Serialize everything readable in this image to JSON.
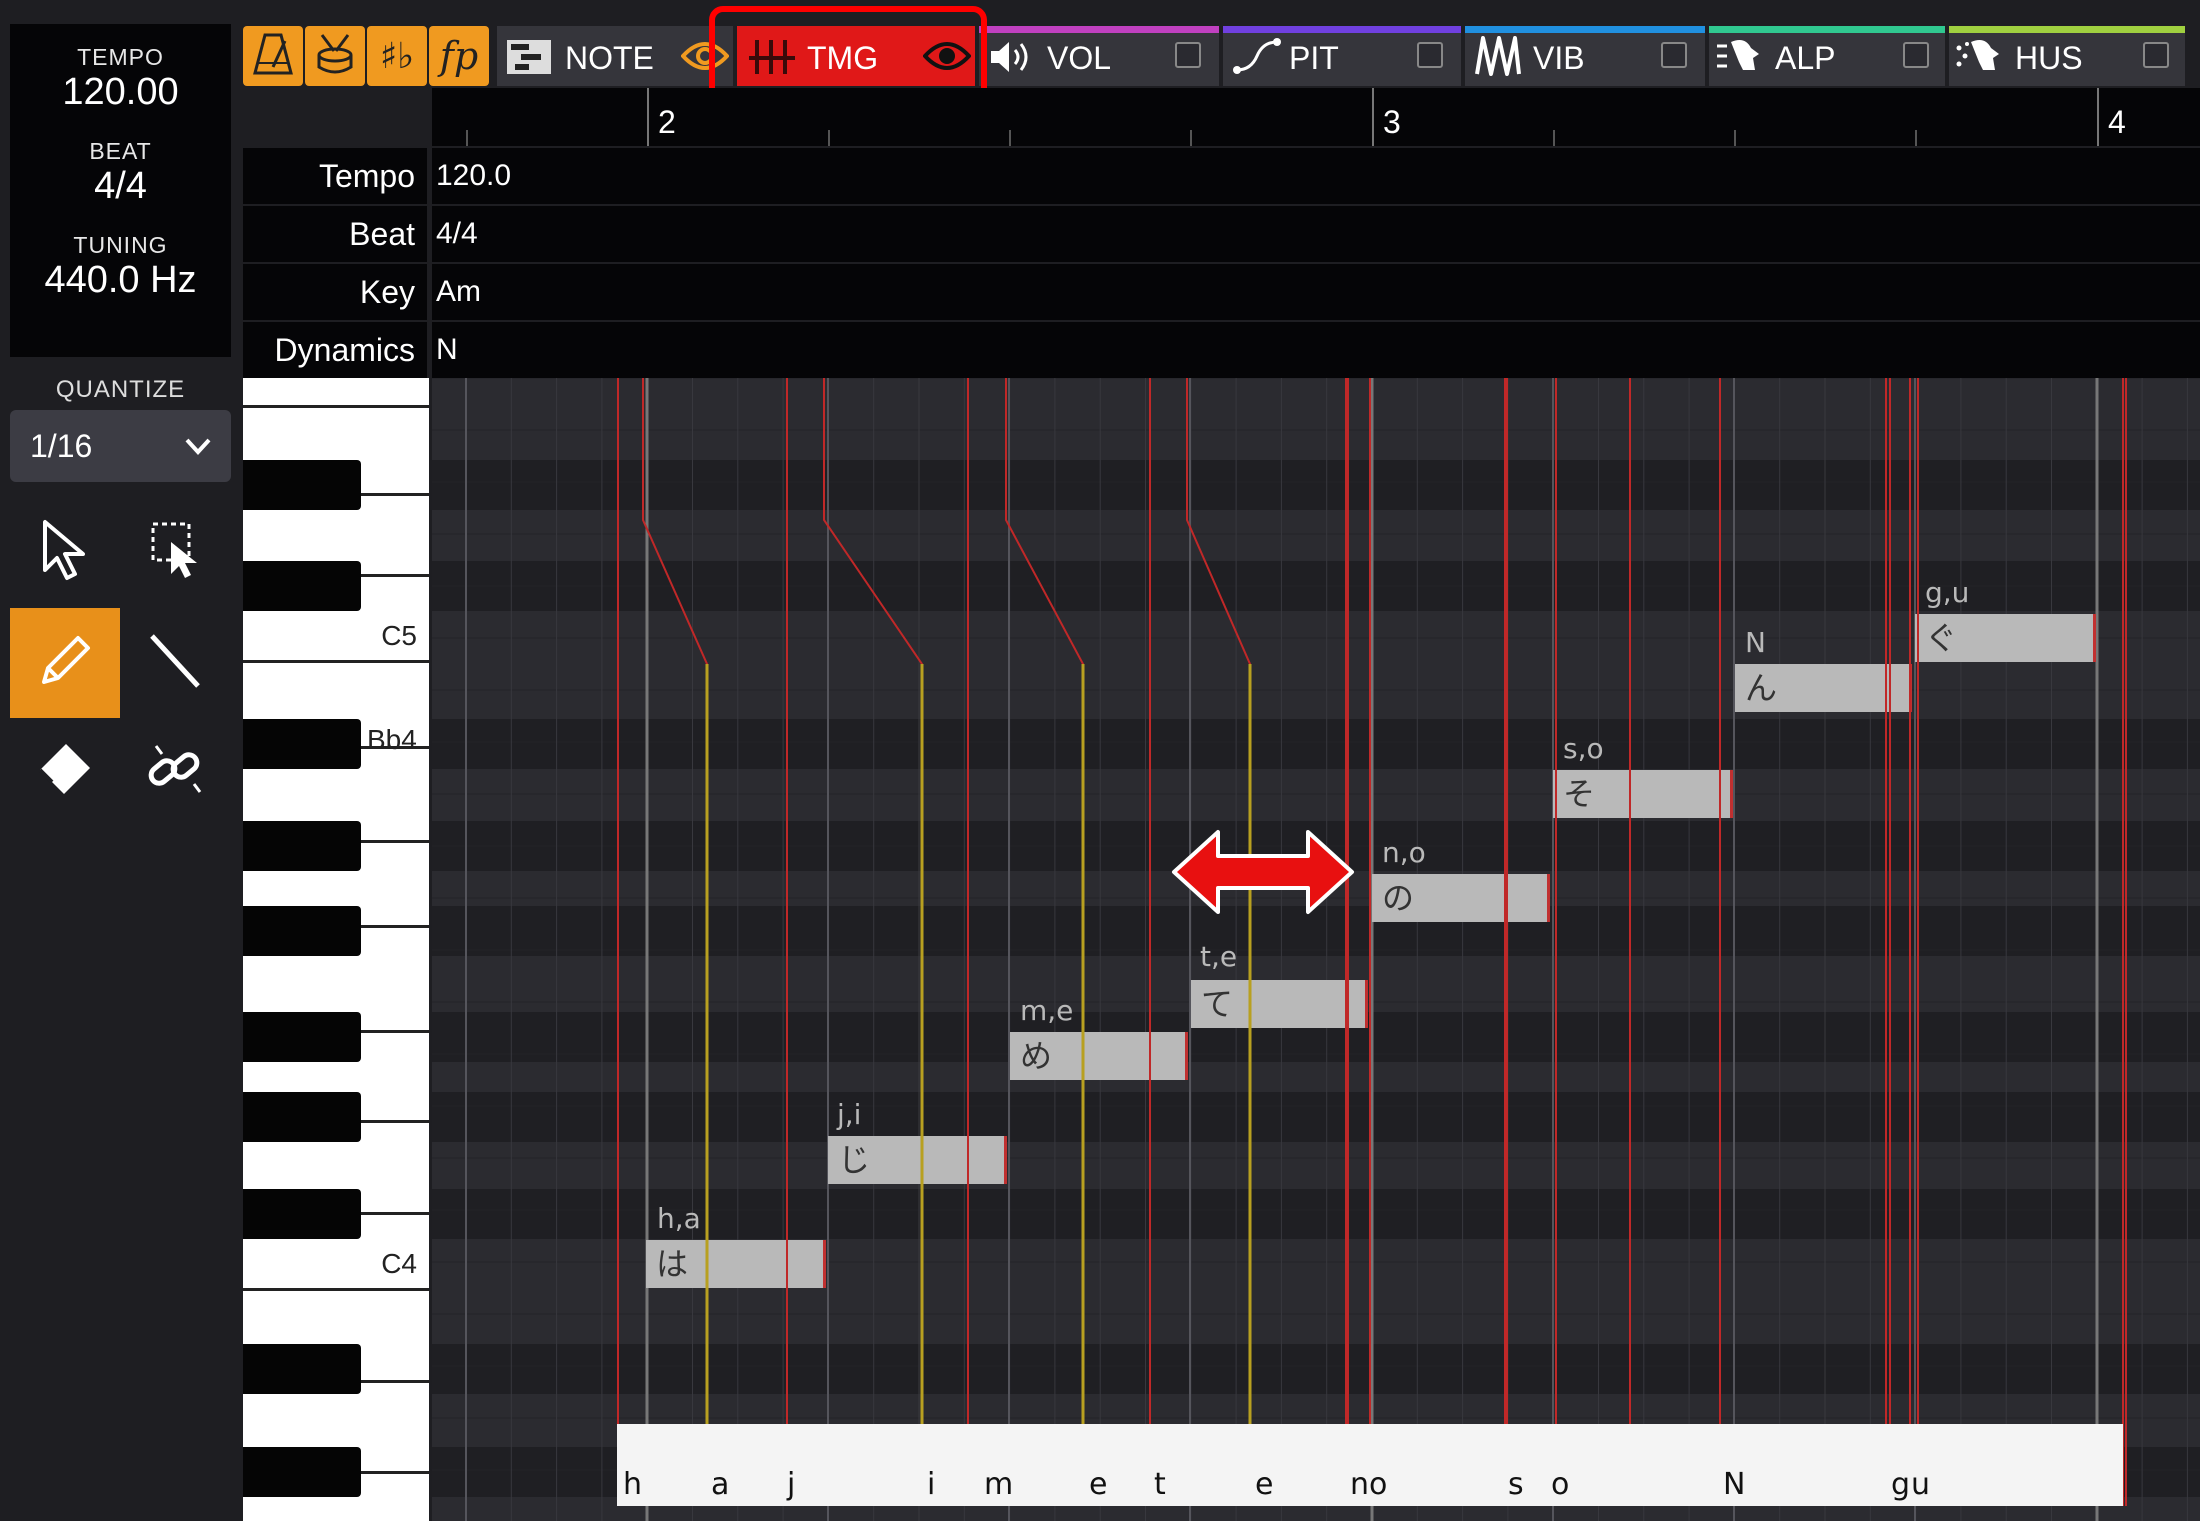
{
  "status": {
    "tempo_label": "TEMPO",
    "tempo_value": "120.00",
    "beat_label": "BEAT",
    "beat_value": "4/4",
    "tuning_label": "TUNING",
    "tuning_value": "440.0 Hz"
  },
  "quantize": {
    "label": "QUANTIZE",
    "value": "1/16"
  },
  "tools": [
    "pointer-icon",
    "range-select-icon",
    "pencil-icon",
    "line-icon",
    "eraser-icon",
    "link-icon"
  ],
  "tabs": {
    "note": "NOTE",
    "tmg": "TMG",
    "vol": "VOL",
    "pit": "PIT",
    "vib": "VIB",
    "alp": "ALP",
    "hus": "HUS"
  },
  "measures": [
    "2",
    "3",
    "4"
  ],
  "info_rows": {
    "tempo_label": "Tempo",
    "tempo_value": "120.0",
    "beat_label": "Beat",
    "beat_value": "4/4",
    "key_label": "Key",
    "key_value": "Am",
    "dynamics_label": "Dynamics",
    "dynamics_value": "N"
  },
  "piano_labels": {
    "c5": "C5",
    "bb4": "Bb4",
    "c4": "C4"
  },
  "notes": [
    {
      "lyric": "は",
      "phonemes": "h,a"
    },
    {
      "lyric": "じ",
      "phonemes": "j,i"
    },
    {
      "lyric": "め",
      "phonemes": "m,e"
    },
    {
      "lyric": "て",
      "phonemes": "t,e"
    },
    {
      "lyric": "の",
      "phonemes": "n,o"
    },
    {
      "lyric": "そ",
      "phonemes": "s,o"
    },
    {
      "lyric": "ん",
      "phonemes": "N"
    },
    {
      "lyric": "ぐ",
      "phonemes": "g,u"
    }
  ],
  "phoneme_strip": [
    "h",
    "a",
    "j",
    "i",
    "m",
    "e",
    "t",
    "e",
    "n",
    "o",
    "s",
    "o",
    "N",
    "g",
    "u"
  ],
  "colors": {
    "accent_orange": "#f09a20",
    "tmg_red": "#e01818",
    "note_gray": "#b9b9b9",
    "timing_line_red": "#c02828",
    "timing_line_yellow": "#b8a020",
    "strip_vol": "#c040c0",
    "strip_pit": "#7040e0",
    "strip_vib": "#2090e0",
    "strip_alp": "#30c890",
    "strip_hus": "#a0d040"
  }
}
